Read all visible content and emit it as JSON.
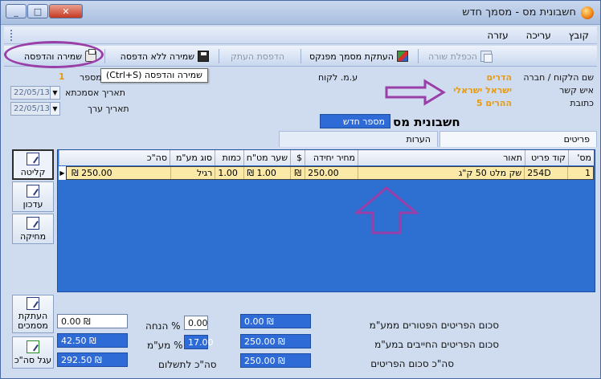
{
  "window": {
    "title": "חשבונית מס  -  מסמך חדש"
  },
  "menu": {
    "items": [
      "קובץ",
      "עריכה",
      "עזרה"
    ]
  },
  "toolbar": {
    "duplicate_row": "הכפלת שורה",
    "copy_from_book": "העתקת מסמך מפנקס",
    "print_copy": "הדפסת העתק",
    "save_no_print": "שמירה ללא הדפסה",
    "save_print": "שמירה והדפסה",
    "tooltip": "שמירה והדפסה (Ctrl+S)"
  },
  "header": {
    "customer_label": "שם הלקוח / חברה",
    "customer_value": "הדרים",
    "contact_label": "איש קשר",
    "contact_value": "ישראל ישראלי",
    "address_label": "כתובת",
    "address_value": "ההרים 5",
    "vat_id_label": "ע.מ. לקוח",
    "number_label": "מספר",
    "number_value": "1",
    "reference_date_label": "תאריך אסמכתא",
    "reference_date": "22/05/13",
    "value_date_label": "תאריך ערך",
    "value_date": "22/05/13",
    "doc_title": "חשבונית מס",
    "new_number": "מספר חדש"
  },
  "tabs": [
    "פריטים",
    "הערות"
  ],
  "grid": {
    "columns": [
      "מס'",
      "קוד פריט",
      "תאור",
      "מחיר יחידה",
      "$",
      "שער מט\"ח",
      "כמות",
      "סוג מע\"מ",
      "סה\"כ"
    ],
    "rows": [
      [
        "1",
        "254D",
        "שק מלט 50 ק\"ג",
        "250.00",
        "₪",
        "1.00 ₪",
        "1.00",
        "רגיל",
        "250.00 ₪"
      ]
    ]
  },
  "side_buttons": {
    "intake": "קליטה",
    "update": "עדכון",
    "delete": "מחיקה",
    "copy_docs": "העתקת מסמכים",
    "round_total": "עגל סה\"כ"
  },
  "totals": {
    "exempt_label": "סכום הפריטים הפטורים ממע\"מ",
    "exempt_value": "0.00 ₪",
    "taxable_label": "סכום הפריטים החייבים במע\"מ",
    "taxable_value": "250.00 ₪",
    "items_total_label": "סה\"כ סכום הפריטים",
    "items_total_value": "250.00 ₪",
    "discount_label": "% הנחה",
    "discount_pct": "0.00",
    "discount_value": "0.00 ₪",
    "vat_label": "% מע\"מ",
    "vat_pct": "17.00",
    "vat_value": "42.50 ₪",
    "to_pay_label": "סה\"כ לתשלום",
    "to_pay_value": "292.50 ₪"
  },
  "colors": {
    "accent_blue": "#2f6bd6",
    "highlight_orange": "#e89a10",
    "annotation_purple": "#9a3ea8",
    "row_yellow": "#fbe9a8"
  }
}
